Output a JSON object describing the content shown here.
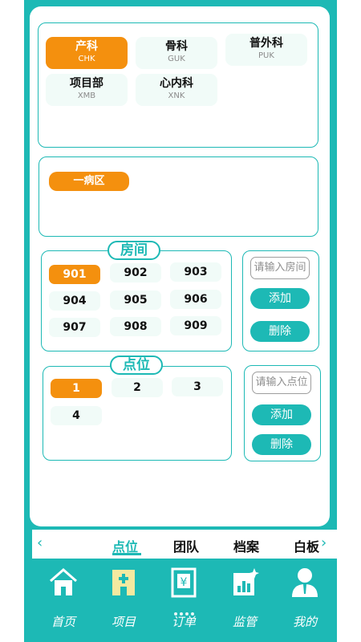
{
  "departments": [
    {
      "name": "产科",
      "code": "CHK",
      "active": true
    },
    {
      "name": "骨科",
      "code": "GUK",
      "active": false
    },
    {
      "name": "普外科",
      "code": "PUK",
      "active": false
    },
    {
      "name": "项目部",
      "code": "XMB",
      "active": false
    },
    {
      "name": "心内科",
      "code": "XNK",
      "active": false
    }
  ],
  "ward": {
    "label": "一病区"
  },
  "rooms": {
    "legend": "房间",
    "items": [
      "901",
      "902",
      "903",
      "904",
      "905",
      "906",
      "907",
      "908",
      "909"
    ],
    "selected": "901",
    "input_placeholder": "请输入房间",
    "add_label": "添加",
    "delete_label": "删除"
  },
  "points": {
    "legend": "点位",
    "items": [
      "1",
      "2",
      "3",
      "4"
    ],
    "selected": "1",
    "input_placeholder": "请输入点位",
    "add_label": "添加",
    "delete_label": "删除"
  },
  "tabs": {
    "items": [
      "点位",
      "团队",
      "档案",
      "白板"
    ],
    "active": "点位",
    "prev_arrow": "‹",
    "next_arrow": "›"
  },
  "bottom_nav": {
    "items": [
      {
        "label": "首页",
        "icon": "home-icon"
      },
      {
        "label": "项目",
        "icon": "hospital-icon"
      },
      {
        "label": "订单",
        "icon": "order-icon"
      },
      {
        "label": "监管",
        "icon": "monitor-chart-icon"
      },
      {
        "label": "我的",
        "icon": "user-icon"
      }
    ]
  },
  "colors": {
    "teal": "#1db9b5",
    "orange": "#f4900e",
    "chip_bg": "#f1fbf8"
  }
}
